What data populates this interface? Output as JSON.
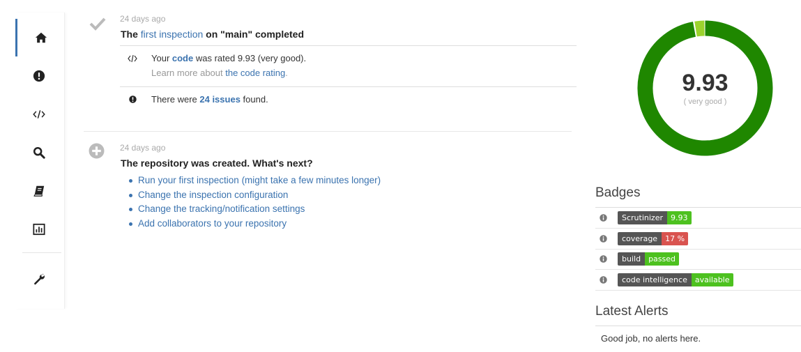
{
  "sidebar": {
    "items": [
      {
        "name": "home-icon",
        "active": true
      },
      {
        "name": "issues-icon",
        "active": false
      },
      {
        "name": "code-icon",
        "active": false
      },
      {
        "name": "search-icon",
        "active": false
      },
      {
        "name": "book-icon",
        "active": false
      },
      {
        "name": "statistics-icon",
        "active": false
      },
      {
        "name": "wrench-icon",
        "active": false
      }
    ]
  },
  "events": {
    "inspection": {
      "time": "24 days ago",
      "title_pre": "The ",
      "title_link": "first inspection",
      "title_post": " on \"main\" completed",
      "rating": {
        "pre": "Your ",
        "link": "code",
        "mid": " was rated ",
        "value": "9.93",
        "post": " (very good).",
        "learn_pre": "Learn more about ",
        "learn_link": "the code rating",
        "learn_post": "."
      },
      "issues": {
        "pre": "There were ",
        "link": "24 issues",
        "post": " found."
      }
    },
    "created": {
      "time": "24 days ago",
      "title": "The repository was created. What's next?",
      "links": [
        "Run your first inspection (might take a few minutes longer)",
        "Change the inspection configuration",
        "Change the tracking/notification settings",
        "Add collaborators to your repository"
      ]
    }
  },
  "score": {
    "value": "9.93",
    "label": "( very good )",
    "fraction": 0.973,
    "colors": {
      "main": "#1f8700",
      "accent": "#9cd32d"
    }
  },
  "badges": {
    "heading": "Badges",
    "items": [
      {
        "left": "Scrutinizer",
        "right": "9.93",
        "color": "#4dc11f"
      },
      {
        "left": "coverage",
        "right": "17 %",
        "color": "#d9534f"
      },
      {
        "left": "build",
        "right": "passed",
        "color": "#4dc11f"
      },
      {
        "left": "code intelligence",
        "right": "available",
        "color": "#4dc11f"
      }
    ]
  },
  "alerts": {
    "heading": "Latest Alerts",
    "text": "Good job, no alerts here."
  }
}
